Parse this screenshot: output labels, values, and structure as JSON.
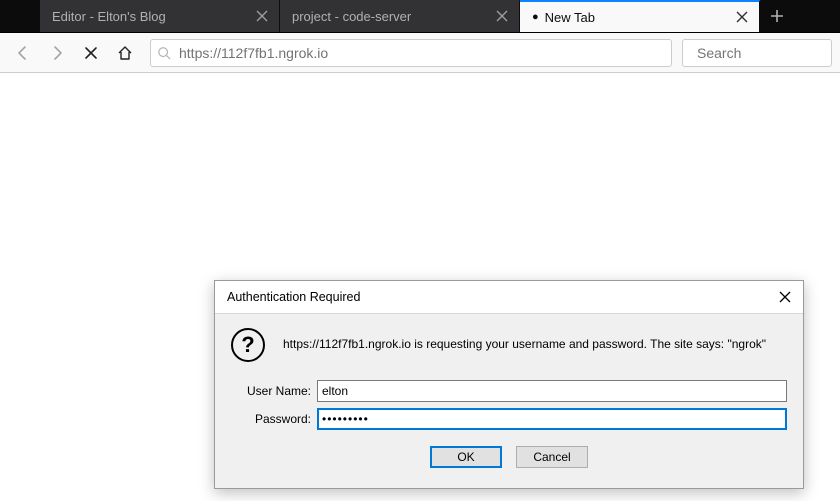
{
  "tabs": [
    {
      "label": "Editor - Elton's Blog",
      "active": false,
      "unread": false
    },
    {
      "label": "project - code-server",
      "active": false,
      "unread": false
    },
    {
      "label": "New Tab",
      "active": true,
      "unread": true
    }
  ],
  "toolbar": {
    "url_value": "https://112f7fb1.ngrok.io",
    "search_placeholder": "Search"
  },
  "dialog": {
    "title": "Authentication Required",
    "message": "https://112f7fb1.ngrok.io is requesting your username and password. The site says: \"ngrok\"",
    "username_label": "User Name:",
    "password_label": "Password:",
    "username_value": "elton",
    "password_value": "•••••••••",
    "ok_label": "OK",
    "cancel_label": "Cancel"
  }
}
